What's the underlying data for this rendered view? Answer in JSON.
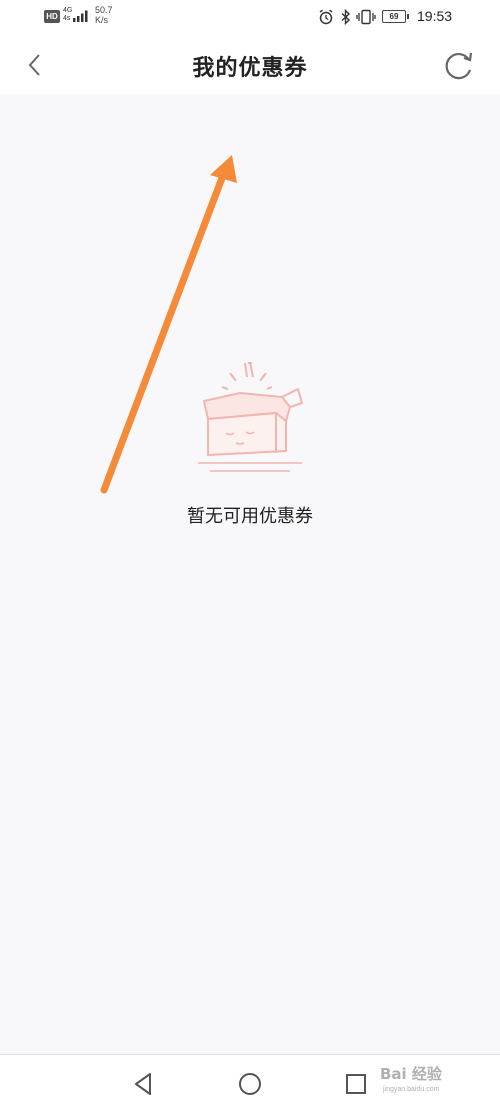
{
  "status_bar": {
    "hd_badge": "HD",
    "network_type": "4G",
    "network_sub": "4s",
    "speed_value": "50.7",
    "speed_unit": "K/s",
    "battery": "69",
    "time": "19:53",
    "icons": [
      "alarm-icon",
      "bluetooth-icon",
      "vibrate-icon"
    ]
  },
  "header": {
    "title": "我的优惠券",
    "back_icon": "chevron-left-icon",
    "refresh_icon": "refresh-icon"
  },
  "content": {
    "empty_message": "暂无可用优惠券",
    "illustration": "empty-box-illustration",
    "annotation": "orange-arrow-icon"
  },
  "bottom_nav": {
    "back_icon": "triangle-back-icon",
    "home_icon": "circle-home-icon",
    "recent_icon": "square-recent-icon"
  },
  "watermark": {
    "text": "Bai 经验",
    "sub": "jingyan.baidu.com"
  },
  "colors": {
    "accent_arrow": "#f58a38",
    "illustration": "#f2b5b0",
    "background": "#f8f8fa"
  }
}
